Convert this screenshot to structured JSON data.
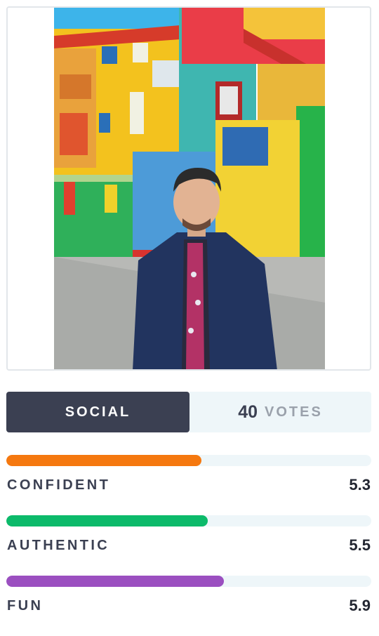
{
  "stats": {
    "category": "SOCIAL",
    "votes_count": "40",
    "votes_label": "VOTES"
  },
  "traits": [
    {
      "name": "CONFIDENT",
      "score": "5.3",
      "fill_fraction": 0.535,
      "color": "#f5780f"
    },
    {
      "name": "AUTHENTIC",
      "score": "5.5",
      "fill_fraction": 0.552,
      "color": "#0cba6a"
    },
    {
      "name": "FUN",
      "score": "5.9",
      "fill_fraction": 0.596,
      "color": "#9b4fc0"
    }
  ],
  "colors": {
    "category_bg": "#3b4052",
    "votes_bg": "#eef6f9",
    "track_bg": "#eef6f9"
  },
  "photo": {
    "subject": "man-in-denim-jacket-before-colorful-houses"
  }
}
